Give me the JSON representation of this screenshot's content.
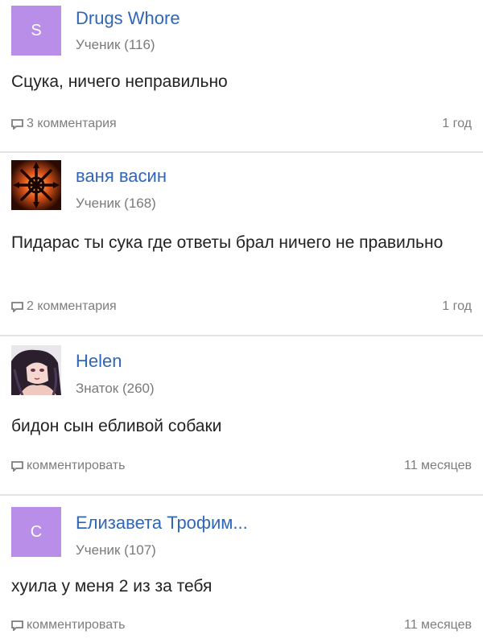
{
  "answers": [
    {
      "username": "Drugs Whore",
      "avatar_letter": "S",
      "avatar_color": "#b88ee8",
      "rank": "Ученик (116)",
      "text": "Сцука, ничего неправильно",
      "comments": "3 комментария",
      "time": "1 год"
    },
    {
      "username": "ваня васин",
      "avatar_icon": "fire-star-avatar-icon",
      "rank": "Ученик (168)",
      "text": "Пидарас ты сука где ответы брал ничего не правильно",
      "comments": "2 комментария",
      "time": "1 год"
    },
    {
      "username": "Helen",
      "avatar_icon": "anime-girl-avatar-icon",
      "rank": "Знаток (260)",
      "text": "бидон сын ебливой собаки",
      "comments": "комментировать",
      "time": "11 месяцев"
    },
    {
      "username": "Елизавета Трофим...",
      "avatar_letter": "С",
      "avatar_color": "#b88ee8",
      "rank": "Ученик (107)",
      "text": "хуила у меня 2 из за тебя",
      "comments": "комментировать",
      "time": "11 месяцев"
    }
  ],
  "colors": {
    "link": "#2f67b8",
    "muted": "#7d7d7d",
    "divider": "#e4e4e4"
  }
}
